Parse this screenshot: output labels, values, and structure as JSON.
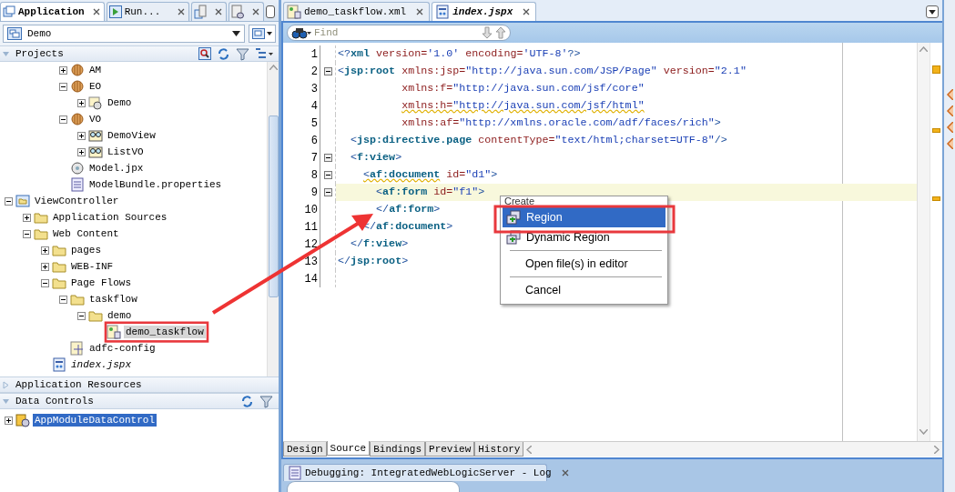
{
  "left_panel": {
    "tabs": [
      {
        "kind": "text",
        "label": "Application",
        "selected": true
      },
      {
        "kind": "text",
        "label": "Run...",
        "selected": false
      },
      {
        "kind": "icon",
        "selected": false
      },
      {
        "kind": "icon",
        "selected": false
      }
    ],
    "application_selector": {
      "value": "Demo"
    },
    "projects": {
      "title": "Projects",
      "expanded": true,
      "focused": false,
      "model_tree": [
        {
          "label": "AM",
          "kind": "package",
          "expanded": false,
          "selected": false
        },
        {
          "label": "EO",
          "kind": "package",
          "expanded": true,
          "selected": false,
          "children": [
            {
              "label": "Demo",
              "kind": "entity",
              "expanded": false,
              "selected": false
            }
          ]
        },
        {
          "label": "VO",
          "kind": "package",
          "expanded": true,
          "selected": false,
          "children": [
            {
              "label": "DemoView",
              "kind": "view",
              "expanded": false,
              "selected": false
            },
            {
              "label": "ListVO",
              "kind": "view",
              "expanded": false,
              "selected": false
            }
          ]
        },
        {
          "label": "Model.jpx",
          "kind": "config",
          "selected": false
        },
        {
          "label": "ModelBundle.properties",
          "kind": "properties",
          "selected": false
        }
      ],
      "viewcontroller_tree": [
        {
          "label": "ViewController",
          "kind": "project",
          "expanded": true,
          "selected": false,
          "children": [
            {
              "label": "Application Sources",
              "kind": "folder",
              "expanded": false,
              "selected": false
            },
            {
              "label": "Web Content",
              "kind": "folder",
              "expanded": true,
              "selected": false,
              "children": [
                {
                  "label": "pages",
                  "kind": "folder",
                  "expanded": false,
                  "selected": false
                },
                {
                  "label": "WEB-INF",
                  "kind": "folder",
                  "expanded": false,
                  "selected": false
                },
                {
                  "label": "Page Flows",
                  "kind": "folder",
                  "expanded": true,
                  "selected": false,
                  "children": [
                    {
                      "label": "taskflow",
                      "kind": "folder",
                      "expanded": true,
                      "selected": false,
                      "children": [
                        {
                          "label": "demo",
                          "kind": "folder",
                          "expanded": true,
                          "selected": false,
                          "children": [
                            {
                              "label": "demo_taskflow",
                              "kind": "taskflow",
                              "selected": true
                            }
                          ]
                        }
                      ]
                    },
                    {
                      "label": "adfc-config",
                      "kind": "flowconfig",
                      "selected": false
                    }
                  ]
                },
                {
                  "label": "index.jspx",
                  "kind": "page",
                  "selected": false,
                  "italic": true
                }
              ]
            }
          ]
        }
      ]
    },
    "application_resources": {
      "title": "Application Resources",
      "expanded": false
    },
    "data_controls": {
      "title": "Data Controls",
      "expanded": true,
      "focused": true,
      "items": [
        {
          "label": "AppModuleDataControl",
          "kind": "datacontrol",
          "expanded": false,
          "selected": true
        }
      ]
    }
  },
  "editor": {
    "tabs": [
      {
        "label": "demo_taskflow.xml",
        "kind": "taskflow",
        "selected": false
      },
      {
        "label": "index.jspx",
        "kind": "page",
        "selected": true
      }
    ],
    "find": {
      "placeholder": "Find"
    },
    "lines": [
      {
        "number": "1",
        "fold": false,
        "current": false,
        "tokens": [
          {
            "kind": "bracket",
            "text": "<?"
          },
          {
            "kind": "tag",
            "text": "xml"
          },
          {
            "kind": "attr",
            "text": " version="
          },
          {
            "kind": "value",
            "text": "'1.0'"
          },
          {
            "kind": "attr",
            "text": " encoding="
          },
          {
            "kind": "value",
            "text": "'UTF-8'"
          },
          {
            "kind": "bracket",
            "text": "?>"
          }
        ]
      },
      {
        "number": "2",
        "fold": true,
        "current": false,
        "tokens": [
          {
            "kind": "bracket",
            "text": "<"
          },
          {
            "kind": "tag",
            "text": "jsp:root"
          },
          {
            "kind": "attr",
            "text": " xmlns:jsp="
          },
          {
            "kind": "value",
            "text": "\"http://java.sun.com/JSP/Page\""
          },
          {
            "kind": "attr",
            "text": " version="
          },
          {
            "kind": "value",
            "text": "\"2.1\""
          }
        ]
      },
      {
        "number": "3",
        "fold": false,
        "current": false,
        "tokens": [
          {
            "kind": "attr",
            "text": "          xmlns:f="
          },
          {
            "kind": "value",
            "text": "\"http://java.sun.com/jsf/core\""
          }
        ]
      },
      {
        "number": "4",
        "fold": false,
        "current": false,
        "tokens": [
          {
            "kind": "attr",
            "text": "          xmlns:h=",
            "warning": true
          },
          {
            "kind": "value",
            "text": "\"http://java.sun.com/jsf/html\"",
            "warning": true
          }
        ]
      },
      {
        "number": "5",
        "fold": false,
        "current": false,
        "tokens": [
          {
            "kind": "attr",
            "text": "          xmlns:af="
          },
          {
            "kind": "value",
            "text": "\"http://xmlns.oracle.com/adf/faces/rich\""
          },
          {
            "kind": "bracket",
            "text": ">"
          }
        ]
      },
      {
        "number": "6",
        "fold": false,
        "current": false,
        "tokens": [
          {
            "kind": "bracket",
            "text": "  <"
          },
          {
            "kind": "tag",
            "text": "jsp:directive.page"
          },
          {
            "kind": "attr",
            "text": " contentType="
          },
          {
            "kind": "value",
            "text": "\"text/html;charset=UTF-8\""
          },
          {
            "kind": "bracket",
            "text": "/>"
          }
        ]
      },
      {
        "number": "7",
        "fold": true,
        "current": false,
        "tokens": [
          {
            "kind": "bracket",
            "text": "  <"
          },
          {
            "kind": "tag",
            "text": "f:view"
          },
          {
            "kind": "bracket",
            "text": ">"
          }
        ]
      },
      {
        "number": "8",
        "fold": true,
        "current": false,
        "tokens": [
          {
            "kind": "bracket",
            "text": "    <",
            "warning": true
          },
          {
            "kind": "tag",
            "text": "af:document",
            "warning": true
          },
          {
            "kind": "attr",
            "text": " id="
          },
          {
            "kind": "value",
            "text": "\"d1\""
          },
          {
            "kind": "bracket",
            "text": ">"
          }
        ]
      },
      {
        "number": "9",
        "fold": true,
        "current": true,
        "tokens": [
          {
            "kind": "bracket",
            "text": "      <"
          },
          {
            "kind": "tag",
            "text": "af:form"
          },
          {
            "kind": "attr",
            "text": " id="
          },
          {
            "kind": "value",
            "text": "\"f1\""
          },
          {
            "kind": "bracket",
            "text": ">"
          }
        ]
      },
      {
        "number": "10",
        "fold": false,
        "current": false,
        "tokens": [
          {
            "kind": "bracket",
            "text": "      </"
          },
          {
            "kind": "tag",
            "text": "af:form"
          },
          {
            "kind": "bracket",
            "text": ">"
          }
        ]
      },
      {
        "number": "11",
        "fold": false,
        "current": false,
        "tokens": [
          {
            "kind": "bracket",
            "text": "    </"
          },
          {
            "kind": "tag",
            "text": "af:document"
          },
          {
            "kind": "bracket",
            "text": ">"
          }
        ]
      },
      {
        "number": "12",
        "fold": false,
        "current": false,
        "tokens": [
          {
            "kind": "bracket",
            "text": "  </"
          },
          {
            "kind": "tag",
            "text": "f:view"
          },
          {
            "kind": "bracket",
            "text": ">"
          }
        ]
      },
      {
        "number": "13",
        "fold": false,
        "current": false,
        "tokens": [
          {
            "kind": "bracket",
            "text": "</"
          },
          {
            "kind": "tag",
            "text": "jsp:root"
          },
          {
            "kind": "bracket",
            "text": ">"
          }
        ]
      },
      {
        "number": "14",
        "fold": false,
        "current": false
      }
    ],
    "context_menu": {
      "header": "Create",
      "items": [
        {
          "kind": "item",
          "label": "Region",
          "icon": true,
          "selected": true
        },
        {
          "kind": "item",
          "label": "Dynamic Region",
          "icon": true,
          "selected": false
        },
        {
          "kind": "separator"
        },
        {
          "kind": "item",
          "label": "Open file(s) in editor",
          "icon": false,
          "selected": false
        },
        {
          "kind": "separator"
        },
        {
          "kind": "item",
          "label": "Cancel",
          "icon": false,
          "selected": false
        }
      ]
    },
    "view_tabs": [
      {
        "label": "Design",
        "selected": false
      },
      {
        "label": "Source",
        "selected": true
      },
      {
        "label": "Bindings",
        "selected": false
      },
      {
        "label": "Preview",
        "selected": false
      },
      {
        "label": "History",
        "selected": false
      }
    ]
  },
  "log_panel": {
    "title": "Debugging: IntegratedWebLogicServer - Log"
  }
}
